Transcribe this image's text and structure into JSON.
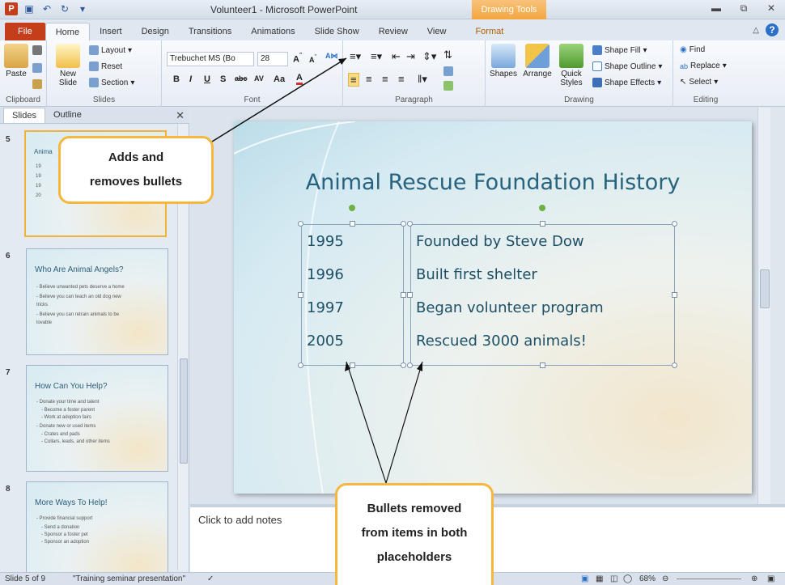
{
  "window": {
    "title": "Volunteer1 - Microsoft PowerPoint",
    "contextual_tab_title": "Drawing Tools",
    "app_icon_letter": "P"
  },
  "tabs": [
    "File",
    "Home",
    "Insert",
    "Design",
    "Transitions",
    "Animations",
    "Slide Show",
    "Review",
    "View",
    "Format"
  ],
  "ribbon": {
    "clipboard": {
      "label": "Clipboard",
      "paste": "Paste"
    },
    "slides": {
      "label": "Slides",
      "new_slide": "New Slide",
      "layout": "Layout",
      "reset": "Reset",
      "section": "Section"
    },
    "font": {
      "label": "Font",
      "font_name": "Trebuchet MS (Bo",
      "font_size": "28"
    },
    "paragraph": {
      "label": "Paragraph"
    },
    "drawing": {
      "label": "Drawing",
      "shapes": "Shapes",
      "arrange": "Arrange",
      "quick_styles": "Quick Styles",
      "shape_fill": "Shape Fill",
      "shape_outline": "Shape Outline",
      "shape_effects": "Shape Effects"
    },
    "editing": {
      "label": "Editing",
      "find": "Find",
      "replace": "Replace",
      "select": "Select"
    }
  },
  "pane": {
    "tab_slides": "Slides",
    "tab_outline": "Outline",
    "thumbnails": [
      {
        "num": "5",
        "title": "Anima",
        "lines": [
          "19",
          "19",
          "19",
          "20"
        ]
      },
      {
        "num": "6",
        "title": "Who Are Animal  Angels?",
        "lines": [
          "- Believe  unwanted  pets deserve  a home",
          "- Believe  you can teach  an old dog  new",
          "  tricks",
          "- Believe  you can retrain  animals  to be",
          "  lovable"
        ]
      },
      {
        "num": "7",
        "title": "How Can You Help?",
        "lines": [
          "- Donate  your time  and talent",
          "  - Become  a foster parent",
          "  - Work at adoption fairs",
          "- Donate  new  or used  items",
          "  - Crates and pads",
          "  - Collars, leads, and other items"
        ]
      },
      {
        "num": "8",
        "title": "More Ways To Help!",
        "lines": [
          "- Provide  financial  support",
          "  - Send a donation",
          "  - Sponsor a foster pet",
          "  - Sponsor an adoption"
        ]
      }
    ]
  },
  "slide": {
    "title": "Animal Rescue Foundation History",
    "years": [
      "1995",
      "1996",
      "1997",
      "2005"
    ],
    "events": [
      "Founded by Steve Dow",
      "Built first shelter",
      "Began volunteer program",
      "Rescued 3000 animals!"
    ]
  },
  "notes": {
    "placeholder": "Click to add notes"
  },
  "status": {
    "slide_info": "Slide 5 of 9",
    "theme": "\"Training seminar presentation\"",
    "zoom": "68%"
  },
  "callouts": {
    "bullets": [
      "Adds and",
      "removes bullets"
    ],
    "removed": [
      "Bullets removed",
      "from items in both",
      "placeholders"
    ]
  }
}
